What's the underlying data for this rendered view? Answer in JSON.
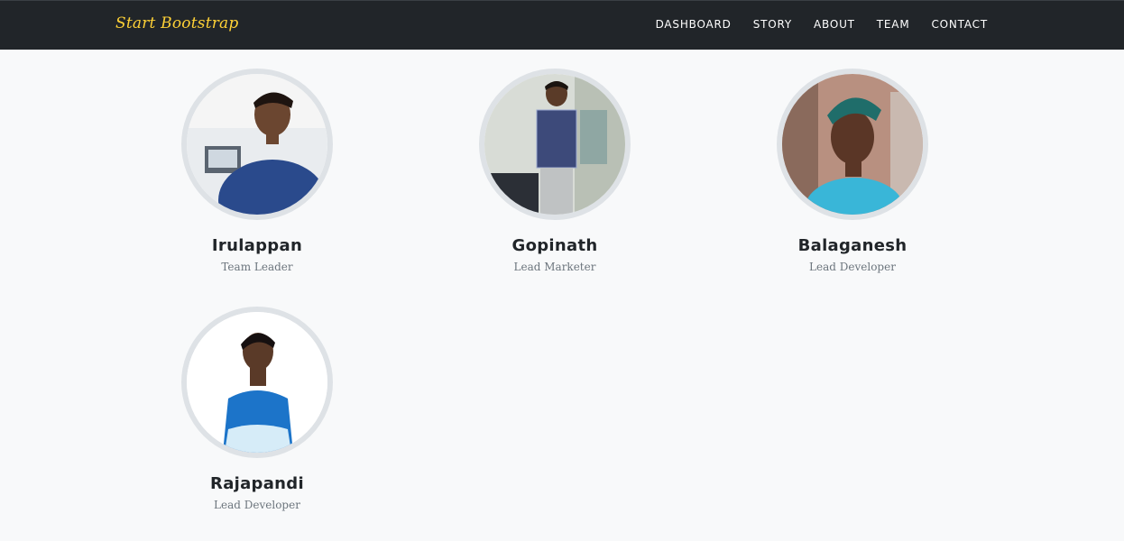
{
  "navbar": {
    "brand": "Start Bootstrap",
    "links": [
      "DASHBOARD",
      "STORY",
      "ABOUT",
      "TEAM",
      "CONTACT"
    ]
  },
  "team": [
    {
      "name": "Irulappan",
      "role": "Team Leader"
    },
    {
      "name": "Gopinath",
      "role": "Lead Marketer"
    },
    {
      "name": "Balaganesh",
      "role": "Lead Developer"
    },
    {
      "name": "Rajapandi",
      "role": "Lead Developer"
    }
  ],
  "colors": {
    "navbar_bg": "#212529",
    "brand": "#fed136",
    "page_bg": "#f8f9fa",
    "avatar_border": "#dee2e6"
  }
}
